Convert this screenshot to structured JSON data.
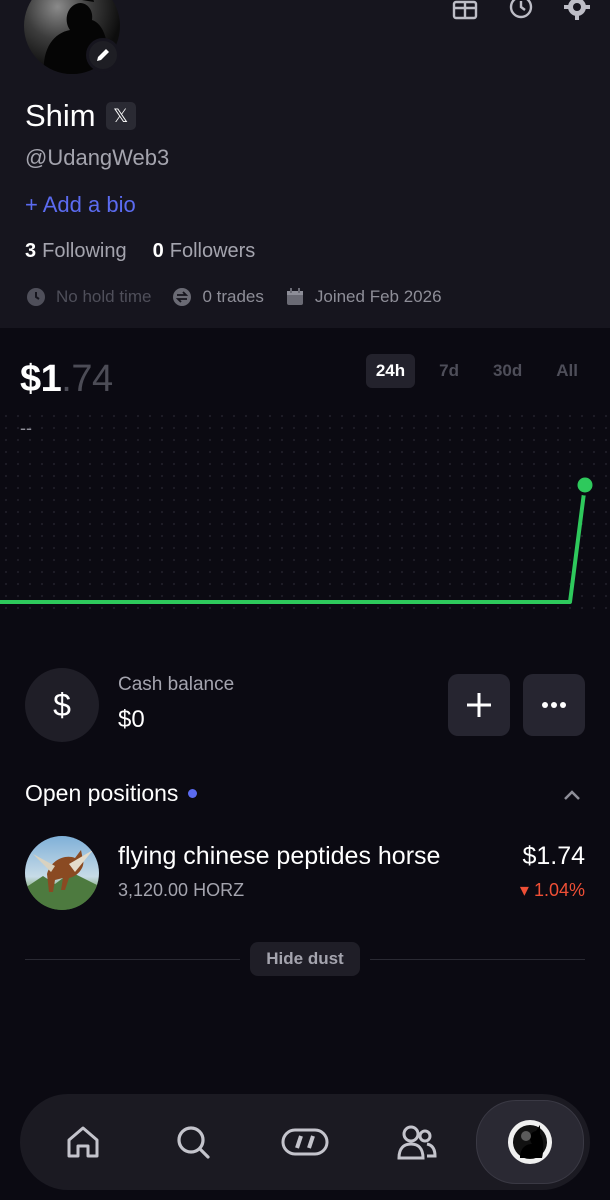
{
  "profile": {
    "name": "Shim",
    "x_badge": "𝕏",
    "handle": "@UdangWeb3",
    "add_bio": "+ Add a bio",
    "following_count": "3",
    "following_label": "Following",
    "followers_count": "0",
    "followers_label": "Followers",
    "hold_time": "No hold time",
    "trades": "0 trades",
    "joined": "Joined Feb 2026"
  },
  "portfolio": {
    "balance_main": "$1",
    "balance_cents": ".74",
    "change": "--",
    "ranges": [
      "24h",
      "7d",
      "30d",
      "All"
    ],
    "active_range": "24h"
  },
  "chart_data": {
    "type": "line",
    "series": [
      {
        "values": [
          0,
          0,
          0,
          0,
          0,
          0,
          0,
          0,
          0,
          0,
          1.74
        ]
      }
    ],
    "line_color": "#2ec95c"
  },
  "cash": {
    "label": "Cash balance",
    "value": "$0",
    "dollar_symbol": "$"
  },
  "positions": {
    "title": "Open positions",
    "items": [
      {
        "name": "flying chinese peptides horse",
        "amount": "3,120.00 HORZ",
        "value": "$1.74",
        "change": "▾ 1.04%"
      }
    ],
    "hide_dust": "Hide dust"
  },
  "nav": {
    "items": [
      "home-icon",
      "search-icon",
      "trade-icon",
      "users-icon",
      "profile-avatar"
    ]
  }
}
